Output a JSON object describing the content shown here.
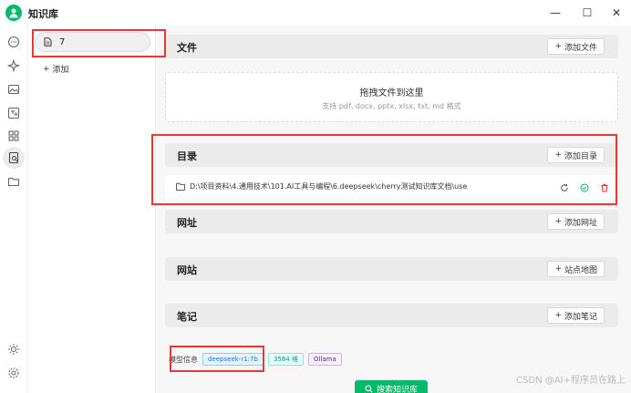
{
  "app": {
    "title": "知识库"
  },
  "window": {
    "minimize": "—",
    "maximize": "☐",
    "close": "✕"
  },
  "sidebar": {
    "icons": [
      "chat-icon",
      "sparkle-icon",
      "image-icon",
      "translate-icon",
      "apps-icon",
      "knowledge-icon",
      "folder-icon"
    ],
    "bottom_icons": [
      "theme-icon",
      "settings-icon"
    ]
  },
  "kb_list": {
    "items": [
      {
        "label": "7"
      }
    ],
    "add_label": "添加"
  },
  "sections": {
    "files": {
      "title": "文件",
      "add_label": "添加文件"
    },
    "dropzone": {
      "title": "拖拽文件到这里",
      "subtitle": "支持 pdf, docx, pptx, xlsx, txt, md 格式"
    },
    "directory": {
      "title": "目录",
      "add_label": "添加目录",
      "path": "D:\\项目资料\\4.通用技术\\101.AI工具与编程\\6.deepseek\\cherry测试知识库文档\\use"
    },
    "urls": {
      "title": "网址",
      "add_label": "添加网址"
    },
    "sitemap": {
      "title": "网站",
      "add_label": "站点地图"
    },
    "notes": {
      "title": "笔记",
      "add_label": "添加笔记"
    }
  },
  "model": {
    "label": "模型信息",
    "model_name": "deepseek-r1:7b",
    "dims": "3584 维",
    "provider": "Ollama"
  },
  "search_button": "搜索知识库",
  "watermark": "CSDN @AI+程序员在路上",
  "colors": {
    "accent": "#00b96b",
    "highlight": "#e53935",
    "danger": "#f5222d"
  }
}
